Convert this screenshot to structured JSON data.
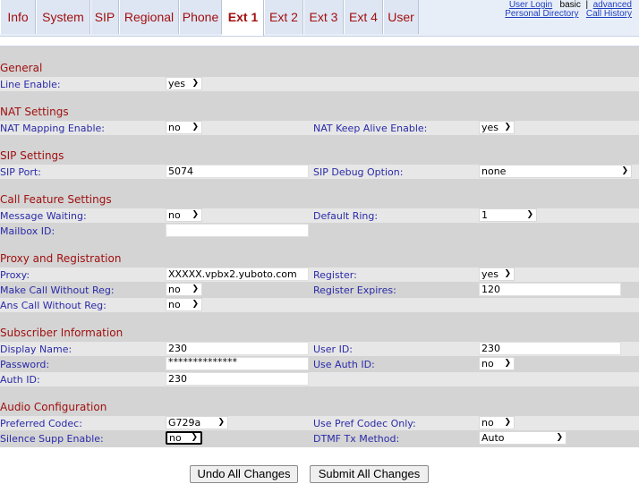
{
  "tabs": [
    "Info",
    "System",
    "SIP",
    "Regional",
    "Phone",
    "Ext 1",
    "Ext 2",
    "Ext 3",
    "Ext 4",
    "User"
  ],
  "toplinks": {
    "user_login": "User Login",
    "basic": "basic",
    "sep": "|",
    "advanced": "advanced",
    "personal_directory": "Personal Directory",
    "call_history": "Call History"
  },
  "sections": {
    "general": "General",
    "nat": "NAT Settings",
    "sip": "SIP Settings",
    "call_feature": "Call Feature Settings",
    "proxy_reg": "Proxy and Registration",
    "subscriber": "Subscriber Information",
    "audio": "Audio Configuration"
  },
  "fields": {
    "line_enable": {
      "label": "Line Enable:",
      "value": "yes"
    },
    "nat_mapping": {
      "label": "NAT Mapping Enable:",
      "value": "no"
    },
    "nat_keepalive": {
      "label": "NAT Keep Alive Enable:",
      "value": "yes"
    },
    "sip_port": {
      "label": "SIP Port:",
      "value": "5074"
    },
    "sip_debug": {
      "label": "SIP Debug Option:",
      "value": "none"
    },
    "message_waiting": {
      "label": "Message Waiting:",
      "value": "no"
    },
    "default_ring": {
      "label": "Default Ring:",
      "value": "1"
    },
    "mailbox_id": {
      "label": "Mailbox ID:",
      "value": ""
    },
    "proxy": {
      "label": "Proxy:",
      "value": "XXXXX.vpbx2.yuboto.com"
    },
    "register": {
      "label": "Register:",
      "value": "yes"
    },
    "make_call_without_reg": {
      "label": "Make Call Without Reg:",
      "value": "no"
    },
    "register_expires": {
      "label": "Register Expires:",
      "value": "120"
    },
    "ans_call_without_reg": {
      "label": "Ans Call Without Reg:",
      "value": "no"
    },
    "display_name": {
      "label": "Display Name:",
      "value": "230"
    },
    "user_id": {
      "label": "User ID:",
      "value": "230"
    },
    "password": {
      "label": "Password:",
      "value": "**************"
    },
    "use_auth_id": {
      "label": "Use Auth ID:",
      "value": "no"
    },
    "auth_id": {
      "label": "Auth ID:",
      "value": "230"
    },
    "preferred_codec": {
      "label": "Preferred Codec:",
      "value": "G729a"
    },
    "use_pref_codec_only": {
      "label": "Use Pref Codec Only:",
      "value": "no"
    },
    "silence_supp": {
      "label": "Silence Supp Enable:",
      "value": "no"
    },
    "dtmf_tx_method": {
      "label": "DTMF Tx Method:",
      "value": "Auto"
    }
  },
  "buttons": {
    "undo": "Undo All Changes",
    "submit": "Submit All Changes"
  },
  "colors": {
    "tab_text": "#a01010",
    "label": "#2a2aa8",
    "section": "#a01010",
    "grey": "#d4d4d4"
  }
}
